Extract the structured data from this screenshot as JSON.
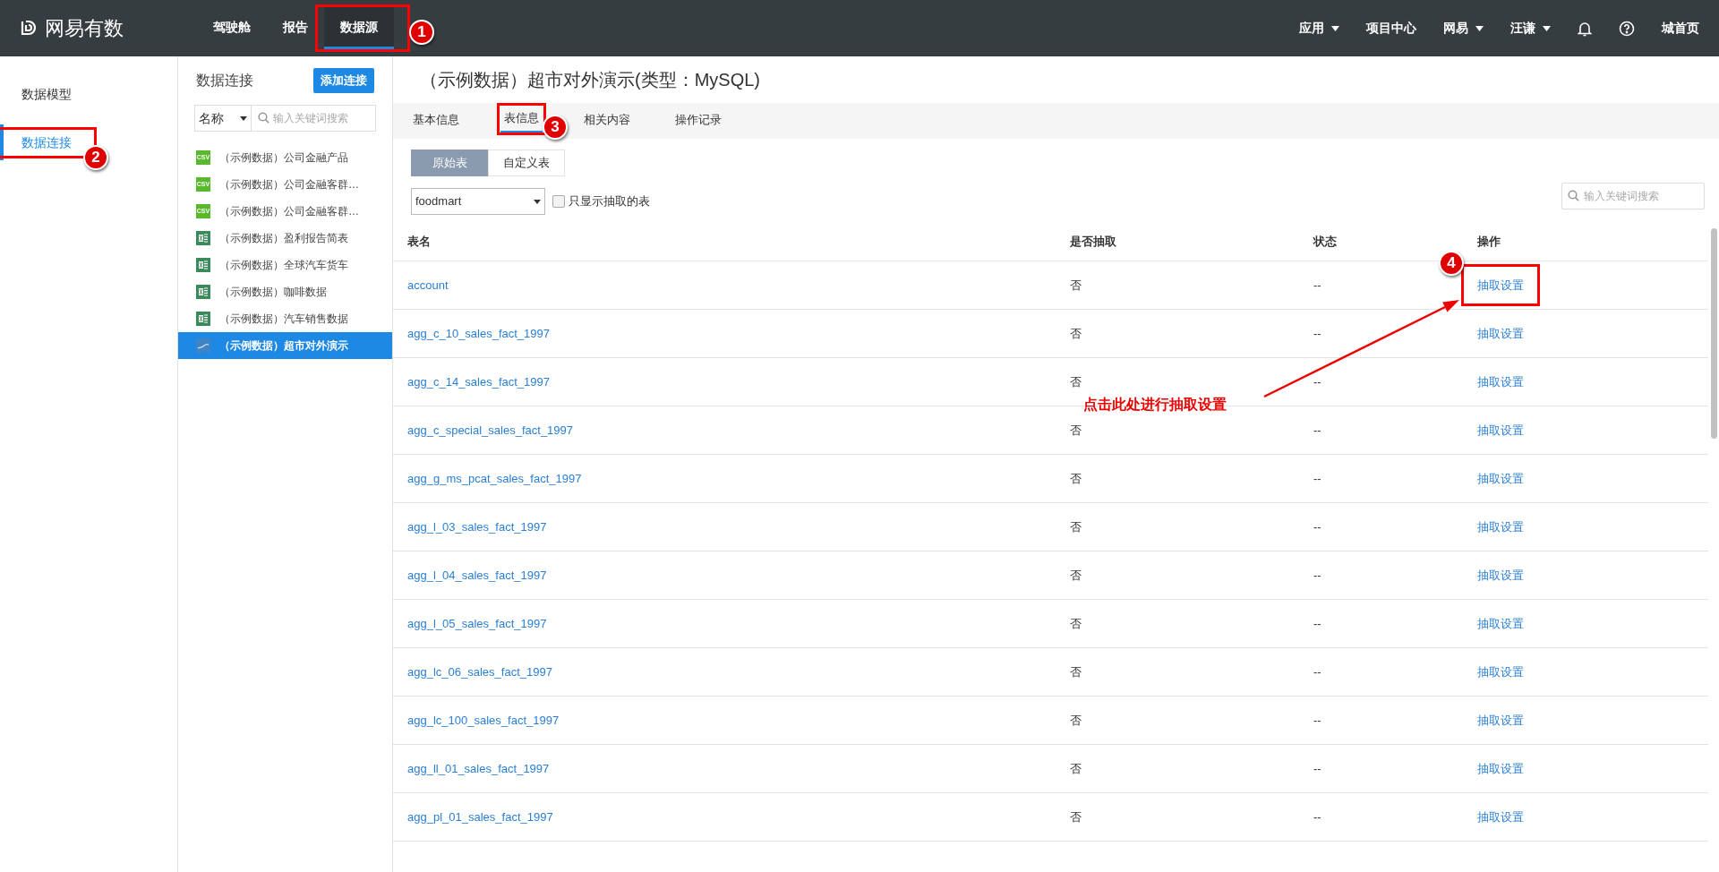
{
  "top_bar": {
    "logo": "网易有数",
    "nav": [
      {
        "label": "驾驶舱",
        "selected": false
      },
      {
        "label": "报告",
        "selected": false
      },
      {
        "label": "数据源",
        "selected": true,
        "callout": "1"
      }
    ],
    "right": [
      {
        "kind": "menu",
        "label": "应用"
      },
      {
        "kind": "link",
        "label": "项目中心"
      },
      {
        "kind": "menu",
        "label": "网易"
      },
      {
        "kind": "menu",
        "label": "汪谦"
      },
      {
        "kind": "bell"
      },
      {
        "kind": "help"
      },
      {
        "kind": "link",
        "label": "城首页"
      }
    ]
  },
  "sidebar": {
    "items": [
      {
        "label": "数据模型",
        "selected": false
      },
      {
        "label": "数据连接",
        "selected": true,
        "callout": "2"
      }
    ]
  },
  "connections": {
    "title": "数据连接",
    "add_button": "添加连接",
    "filter": "名称",
    "search": {
      "placeholder": "输入关键词搜索"
    },
    "items": [
      {
        "kind": "csv",
        "badge": "CSV",
        "label": "（示例数据）公司金融产品",
        "selected": false
      },
      {
        "kind": "csv",
        "badge": "CSV",
        "label": "（示例数据）公司金融客群…",
        "selected": false
      },
      {
        "kind": "csv",
        "badge": "CSV",
        "label": "（示例数据）公司金融客群…",
        "selected": false
      },
      {
        "kind": "excel",
        "label": "（示例数据）盈利报告简表",
        "selected": false
      },
      {
        "kind": "excel",
        "label": "（示例数据）全球汽车货车",
        "selected": false
      },
      {
        "kind": "excel",
        "label": "（示例数据）咖啡数据",
        "selected": false
      },
      {
        "kind": "excel",
        "label": "（示例数据）汽车销售数据",
        "selected": false
      },
      {
        "kind": "mysql",
        "label": "（示例数据）超市对外演示",
        "selected": true
      }
    ]
  },
  "main": {
    "title": "（示例数据）超市对外演示(类型：MySQL)",
    "tabs": [
      {
        "label": "基本信息",
        "selected": false
      },
      {
        "label": "表信息",
        "selected": true,
        "callout": "3"
      },
      {
        "label": "相关内容",
        "selected": false
      },
      {
        "label": "操作记录",
        "selected": false
      }
    ],
    "segments": [
      {
        "label": "原始表",
        "selected": true
      },
      {
        "label": "自定义表",
        "selected": false
      }
    ],
    "database": "foodmart",
    "only_extracted": {
      "label": "只显示抽取的表",
      "checked": false
    },
    "search": {
      "placeholder": "输入关键词搜索"
    },
    "table": {
      "columns": [
        "表名",
        "是否抽取",
        "状态",
        "操作"
      ],
      "rows": [
        {
          "name": "account",
          "extracted": "否",
          "status": "--",
          "action": "抽取设置",
          "callout": "4"
        },
        {
          "name": "agg_c_10_sales_fact_1997",
          "extracted": "否",
          "status": "--",
          "action": "抽取设置"
        },
        {
          "name": "agg_c_14_sales_fact_1997",
          "extracted": "否",
          "status": "--",
          "action": "抽取设置"
        },
        {
          "name": "agg_c_special_sales_fact_1997",
          "extracted": "否",
          "status": "--",
          "action": "抽取设置"
        },
        {
          "name": "agg_g_ms_pcat_sales_fact_1997",
          "extracted": "否",
          "status": "--",
          "action": "抽取设置"
        },
        {
          "name": "agg_l_03_sales_fact_1997",
          "extracted": "否",
          "status": "--",
          "action": "抽取设置"
        },
        {
          "name": "agg_l_04_sales_fact_1997",
          "extracted": "否",
          "status": "--",
          "action": "抽取设置"
        },
        {
          "name": "agg_l_05_sales_fact_1997",
          "extracted": "否",
          "status": "--",
          "action": "抽取设置"
        },
        {
          "name": "agg_lc_06_sales_fact_1997",
          "extracted": "否",
          "status": "--",
          "action": "抽取设置"
        },
        {
          "name": "agg_lc_100_sales_fact_1997",
          "extracted": "否",
          "status": "--",
          "action": "抽取设置"
        },
        {
          "name": "agg_ll_01_sales_fact_1997",
          "extracted": "否",
          "status": "--",
          "action": "抽取设置"
        },
        {
          "name": "agg_pl_01_sales_fact_1997",
          "extracted": "否",
          "status": "--",
          "action": "抽取设置"
        }
      ]
    }
  },
  "annotation": {
    "text": "点击此处进行抽取设置"
  }
}
